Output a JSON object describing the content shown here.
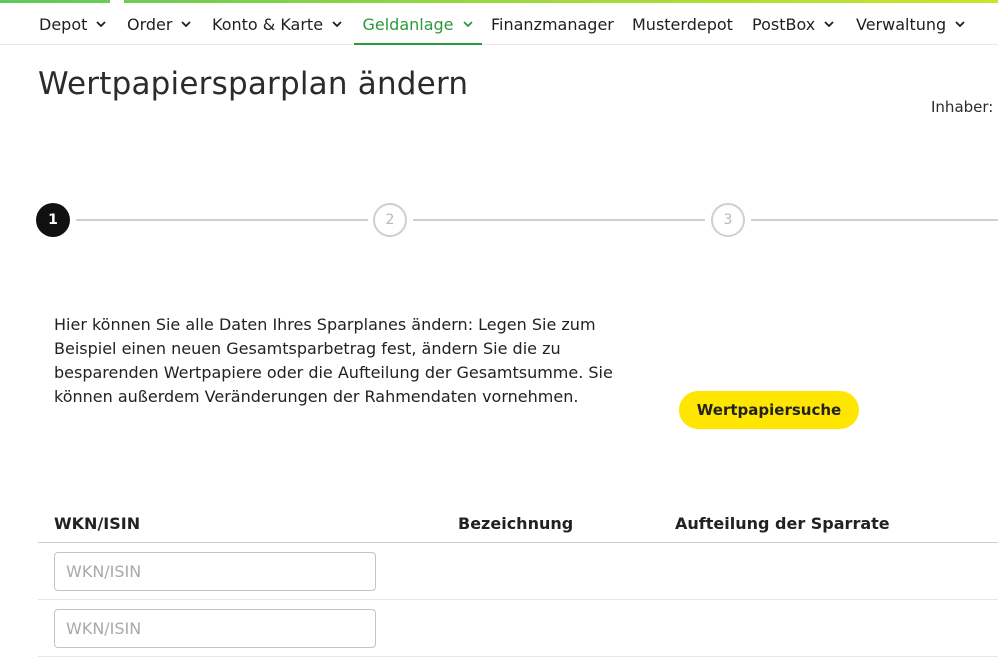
{
  "nav": {
    "items": [
      {
        "label": "Depot",
        "dropdown": true,
        "active": false
      },
      {
        "label": "Order",
        "dropdown": true,
        "active": false
      },
      {
        "label": "Konto & Karte",
        "dropdown": true,
        "active": false
      },
      {
        "label": "Geldanlage",
        "dropdown": true,
        "active": true
      },
      {
        "label": "Finanzmanager",
        "dropdown": false,
        "active": false
      },
      {
        "label": "Musterdepot",
        "dropdown": false,
        "active": false
      },
      {
        "label": "PostBox",
        "dropdown": true,
        "active": false
      },
      {
        "label": "Verwaltung",
        "dropdown": true,
        "active": false
      }
    ]
  },
  "page": {
    "title": "Wertpapiersparplan ändern",
    "owner_label": "Inhaber:"
  },
  "stepper": {
    "steps": [
      {
        "number": "1",
        "active": true
      },
      {
        "number": "2",
        "active": false
      },
      {
        "number": "3",
        "active": false
      }
    ]
  },
  "intro": {
    "text": "Hier können Sie alle Daten Ihres Sparplanes ändern: Legen Sie zum Beispiel einen neuen Gesamtsparbetrag fest, ändern Sie die zu besparenden Wertpapiere oder die Aufteilung der Gesamtsumme. Sie können außerdem Veränderungen der Rahmendaten vornehmen."
  },
  "search_button": {
    "label": "Wertpapiersuche"
  },
  "table": {
    "headers": {
      "wkn": "WKN/ISIN",
      "name": "Bezeichnung",
      "split": "Aufteilung der Sparrate"
    },
    "rows": [
      {
        "wkn_placeholder": "WKN/ISIN",
        "wkn_value": ""
      },
      {
        "wkn_placeholder": "WKN/ISIN",
        "wkn_value": ""
      }
    ]
  },
  "colors": {
    "accent_green": "#2b9a3c",
    "button_yellow": "#ffe600"
  },
  "icons": {
    "dropdown": "chevron-down-icon"
  }
}
